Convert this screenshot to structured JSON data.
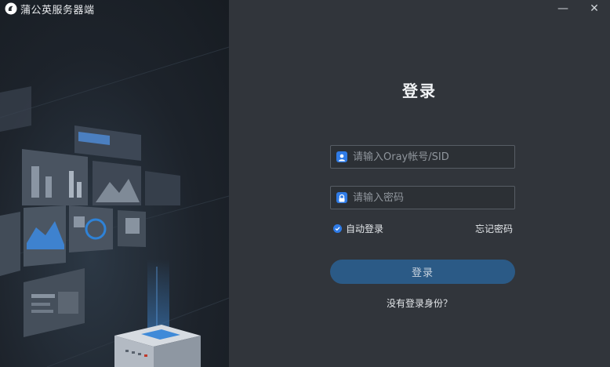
{
  "window": {
    "title": "蒲公英服务器端",
    "minimize_glyph": "—",
    "close_glyph": "✕"
  },
  "icons": {
    "app_logo": "dandelion-logo-icon",
    "account": "user-icon",
    "password": "lock-icon",
    "checkbox": "check-icon"
  },
  "colors": {
    "accent": "#2f7be6",
    "login_button": "#2b5a86",
    "panel": "#31353b"
  },
  "login": {
    "heading": "登录",
    "account_placeholder": "请输入Oray帐号/SID",
    "password_placeholder": "请输入密码",
    "auto_login_label": "自动登录",
    "auto_login_checked": true,
    "forgot_password": "忘记密码",
    "submit_label": "登录",
    "no_identity_link": "没有登录身份？"
  }
}
